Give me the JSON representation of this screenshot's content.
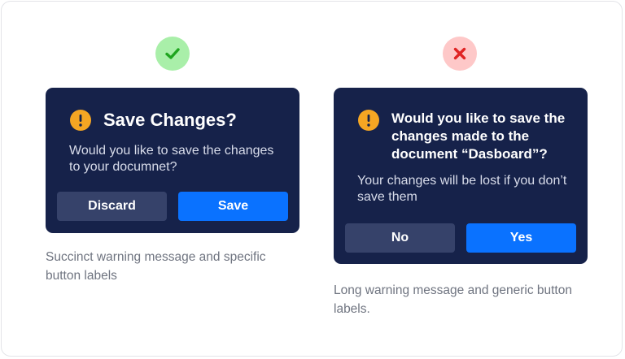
{
  "good_example": {
    "indicator_icon": "checkmark-icon",
    "indicator_color": "#a9efa9",
    "dialog": {
      "icon": "warning-icon",
      "title": "Save Changes?",
      "body": "Would you like to save the changes to your documnet?",
      "secondary_button": "Discard",
      "primary_button": "Save"
    },
    "caption": "Succinct warning message and specific button labels"
  },
  "bad_example": {
    "indicator_icon": "x-mark-icon",
    "indicator_color": "#fec8c8",
    "dialog": {
      "icon": "warning-icon",
      "title": "Would you like to save the changes made to the document “Dasboard”?",
      "body": "Your changes will be lost if you don’t save them",
      "secondary_button": "No",
      "primary_button": "Yes"
    },
    "caption": "Long warning message and generic button labels."
  },
  "colors": {
    "dialog_background": "#16224a",
    "primary_button": "#0a72ff",
    "secondary_button": "#36426a",
    "warning": "#f5a623",
    "success": "#2bb82b",
    "danger": "#e02424"
  }
}
